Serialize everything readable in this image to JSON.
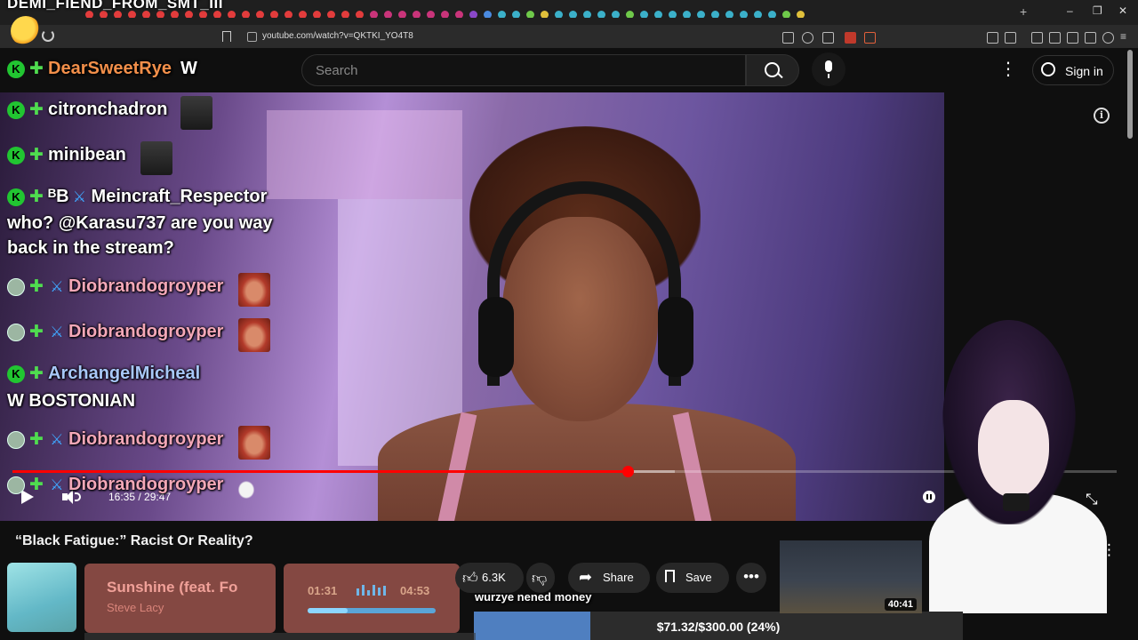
{
  "browser": {
    "overlay_title": "DEMI_FIEND_FROM_SMT_III",
    "url": "youtube.com/watch?v=QKTKI_YO4T8",
    "tab_dot_colors": [
      "#e23c3c",
      "#e23c3c",
      "#e23c3c",
      "#e23c3c",
      "#e23c3c",
      "#e23c3c",
      "#e23c3c",
      "#e23c3c",
      "#e23c3c",
      "#e23c3c",
      "#e23c3c",
      "#e23c3c",
      "#e23c3c",
      "#e23c3c",
      "#e23c3c",
      "#e23c3c",
      "#e23c3c",
      "#e23c3c",
      "#e23c3c",
      "#e23c3c",
      "#c9347a",
      "#c9347a",
      "#c9347a",
      "#c9347a",
      "#c9347a",
      "#c9347a",
      "#c9347a",
      "#8a48c9",
      "#4a8ae0",
      "#3bb0c9",
      "#3bb0c9",
      "#6fc94a",
      "#e0c03b",
      "#3bb0c9",
      "#3bb0c9",
      "#3bb0c9",
      "#3bb0c9",
      "#3bb0c9",
      "#6fc94a",
      "#3bb0c9",
      "#3bb0c9",
      "#3bb0c9",
      "#3bb0c9",
      "#3bb0c9",
      "#3bb0c9",
      "#3bb0c9",
      "#3bb0c9",
      "#3bb0c9",
      "#3bb0c9",
      "#6fc94a",
      "#e0c03b"
    ],
    "window_controls": [
      "–",
      "❐",
      "✕"
    ]
  },
  "youtube": {
    "search_placeholder": "Search",
    "signin_label": "Sign in",
    "more_label": "⋮"
  },
  "player": {
    "elapsed": "16:35",
    "total": "29:47",
    "time_display": "16:35 / 29:47",
    "progress_fraction": 0.557,
    "buffered_fraction": 0.6,
    "info_label": "i",
    "fullscreen_glyph": "⤡"
  },
  "chat": {
    "messages": [
      {
        "user": "DearSweetRye",
        "user_color": "#f28f4a",
        "text": "W",
        "badges": [
          "k",
          "diamond"
        ]
      },
      {
        "user": "citronchadron",
        "user_color": "#ffffff",
        "text": "",
        "badges": [
          "k",
          "diamond"
        ]
      },
      {
        "user": "minibean",
        "user_color": "#ffffff",
        "text": "",
        "badges": [
          "k",
          "diamond"
        ]
      },
      {
        "user": "Meincraft_Respector",
        "user_color": "#ffffff",
        "prefix": "ᴮB",
        "text": "who? @Karasu737 are you way back in the stream?",
        "text_line1": "who? @Karasu737 are you way",
        "text_line2": "back in the stream?",
        "badges": [
          "k",
          "diamond",
          "sword"
        ]
      },
      {
        "user": "Diobrandogroyper",
        "user_color": "#f4a8b8",
        "text": "",
        "badges": [
          "bot",
          "diamond",
          "sword"
        ]
      },
      {
        "user": "Diobrandogroyper",
        "user_color": "#f4a8b8",
        "text": "",
        "badges": [
          "bot",
          "diamond",
          "sword"
        ]
      },
      {
        "user": "ArchangelMicheal",
        "user_color": "#a8c8f8",
        "text": "W BOSTONIAN",
        "badges": [
          "k",
          "diamond"
        ]
      },
      {
        "user": "Diobrandogroyper",
        "user_color": "#f4a8b8",
        "text": "",
        "badges": [
          "bot",
          "diamond",
          "sword"
        ]
      },
      {
        "user": "Diobrandogroyper",
        "user_color": "#f4a8b8",
        "text": "",
        "badges": [
          "bot",
          "diamond",
          "sword"
        ]
      }
    ]
  },
  "video": {
    "title": "“Black Fatigue:” Racist Or Reality?",
    "likes": "6.3K",
    "share_label": "Share",
    "save_label": "Save",
    "more_actions": "•••"
  },
  "music_widget": {
    "title": "Sunshine (feat. Fo",
    "artist": "Steve Lacy",
    "elapsed": "01:31",
    "duration": "04:53",
    "progress_fraction": 0.31
  },
  "donation": {
    "message": "wurzye nened money",
    "label": "$71.32/$300.00 (24%)",
    "fraction": 0.2377
  },
  "recommendation": {
    "duration": "40:41"
  }
}
